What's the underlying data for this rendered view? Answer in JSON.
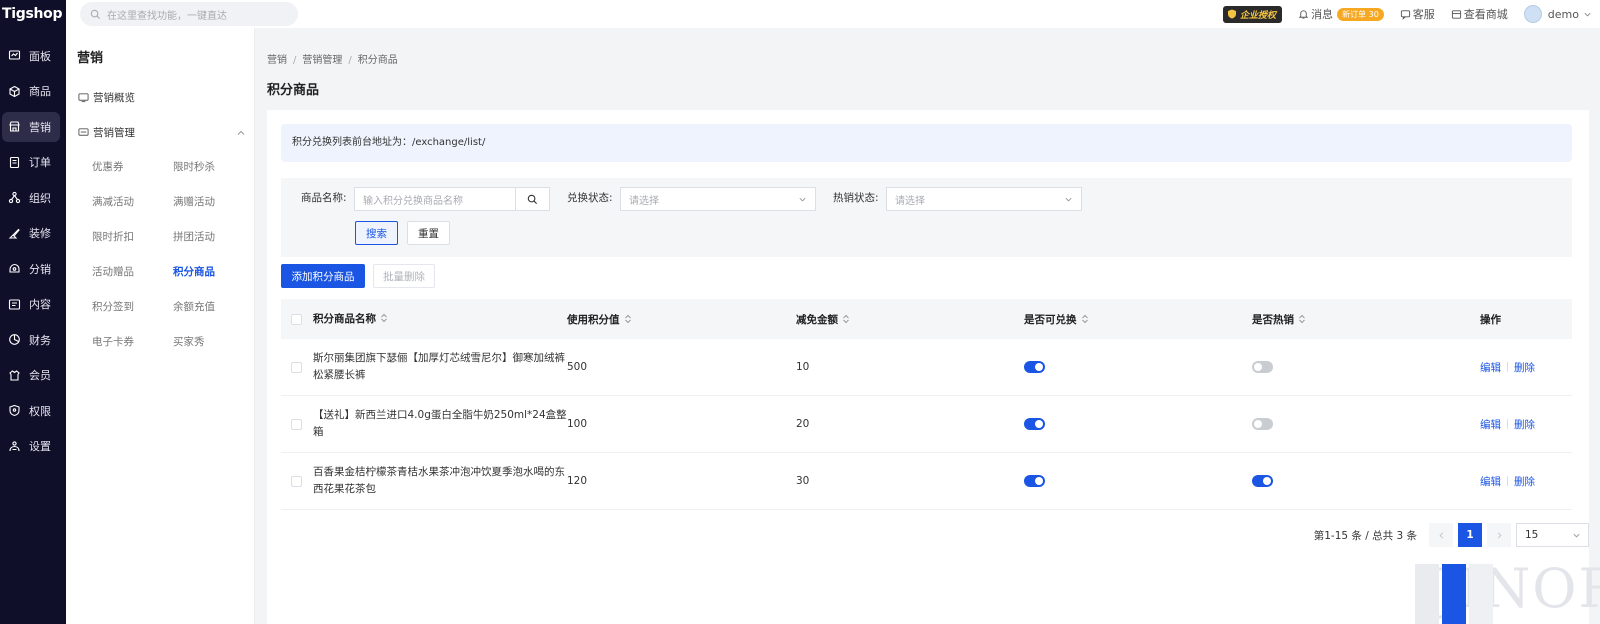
{
  "app": {
    "logo": "Tigshop"
  },
  "topbar": {
    "search_placeholder": "在这里查找功能，一键直达",
    "auth_badge": "企业授权",
    "messages_label": "消息",
    "new_orders_badge": "新订单 30",
    "service_label": "客服",
    "store_label": "查看商城",
    "user_name": "demo"
  },
  "sidebar": {
    "items": [
      {
        "label": "面板",
        "icon": "dashboard-icon"
      },
      {
        "label": "商品",
        "icon": "box-icon"
      },
      {
        "label": "营销",
        "icon": "store-icon"
      },
      {
        "label": "订单",
        "icon": "order-icon"
      },
      {
        "label": "组织",
        "icon": "org-icon"
      },
      {
        "label": "装修",
        "icon": "brush-icon"
      },
      {
        "label": "分销",
        "icon": "share-icon"
      },
      {
        "label": "内容",
        "icon": "content-icon"
      },
      {
        "label": "财务",
        "icon": "finance-icon"
      },
      {
        "label": "会员",
        "icon": "member-icon"
      },
      {
        "label": "权限",
        "icon": "shield-icon"
      },
      {
        "label": "设置",
        "icon": "settings-icon"
      }
    ],
    "active_index": 2
  },
  "submenu": {
    "title": "营销",
    "overview_label": "营销概览",
    "group_label": "营销管理",
    "items": [
      "优惠券",
      "限时秒杀",
      "满减活动",
      "满赠活动",
      "限时折扣",
      "拼团活动",
      "活动赠品",
      "积分商品",
      "积分签到",
      "余额充值",
      "电子卡券",
      "买家秀"
    ],
    "active_item": "积分商品"
  },
  "breadcrumb": [
    "营销",
    "营销管理",
    "积分商品"
  ],
  "page_title": "积分商品",
  "notice": "积分兑换列表前台地址为：/exchange/list/",
  "filter": {
    "name_label": "商品名称:",
    "name_placeholder": "输入积分兑换商品名称",
    "exchange_label": "兑换状态:",
    "exchange_placeholder": "请选择",
    "hot_label": "热销状态:",
    "hot_placeholder": "请选择",
    "search_button": "搜索",
    "reset_button": "重置"
  },
  "actions": {
    "add_button": "添加积分商品",
    "batch_delete_button": "批量删除"
  },
  "table": {
    "headers": [
      "积分商品名称",
      "使用积分值",
      "减免金额",
      "是否可兑换",
      "是否热销",
      "操作"
    ],
    "rows": [
      {
        "name": "斯尔丽集团旗下瑟俪【加厚灯芯绒雪尼尔】御寒加绒裤松紧腰长裤",
        "points": "500",
        "discount": "10",
        "exchangeable": true,
        "hot": false
      },
      {
        "name": "【送礼】新西兰进口4.0g蛋白全脂牛奶250ml*24盒整箱",
        "points": "100",
        "discount": "20",
        "exchangeable": true,
        "hot": false
      },
      {
        "name": "百香果金桔柠檬茶青桔水果茶冲泡冲饮夏季泡水喝的东西花果花茶包",
        "points": "120",
        "discount": "30",
        "exchangeable": true,
        "hot": true
      }
    ],
    "edit_label": "编辑",
    "delete_label": "删除"
  },
  "pagination": {
    "summary": "第1-15 条 / 总共 3 条",
    "current_page": "1",
    "page_size": "15"
  },
  "watermark": "JINOR",
  "colors": {
    "primary": "#1a55e3",
    "sidebar_bg": "#0f0f2a",
    "new_order_badge": "#f7a823"
  }
}
